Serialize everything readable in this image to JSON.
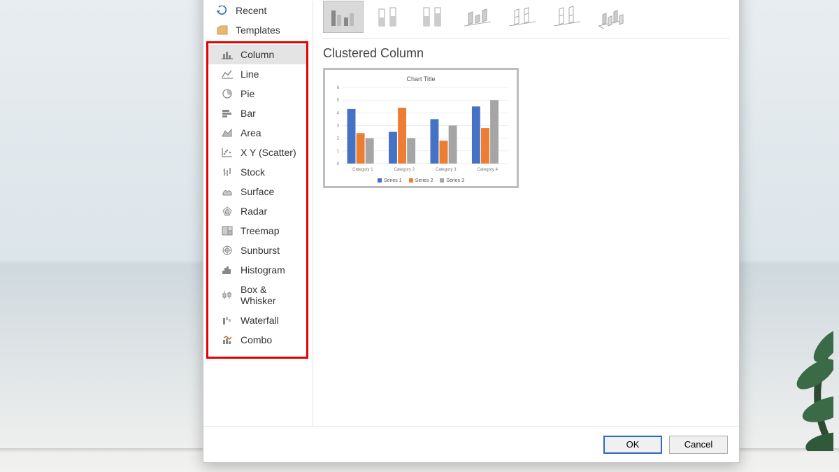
{
  "sidebar": {
    "top": [
      {
        "label": "Recent",
        "icon": "recent-icon"
      },
      {
        "label": "Templates",
        "icon": "templates-icon"
      }
    ],
    "charts": [
      {
        "label": "Column",
        "icon": "column-icon",
        "selected": true
      },
      {
        "label": "Line",
        "icon": "line-icon"
      },
      {
        "label": "Pie",
        "icon": "pie-icon"
      },
      {
        "label": "Bar",
        "icon": "bar-icon"
      },
      {
        "label": "Area",
        "icon": "area-icon"
      },
      {
        "label": "X Y (Scatter)",
        "icon": "scatter-icon"
      },
      {
        "label": "Stock",
        "icon": "stock-icon"
      },
      {
        "label": "Surface",
        "icon": "surface-icon"
      },
      {
        "label": "Radar",
        "icon": "radar-icon"
      },
      {
        "label": "Treemap",
        "icon": "treemap-icon"
      },
      {
        "label": "Sunburst",
        "icon": "sunburst-icon"
      },
      {
        "label": "Histogram",
        "icon": "histogram-icon"
      },
      {
        "label": "Box & Whisker",
        "icon": "boxwhisker-icon"
      },
      {
        "label": "Waterfall",
        "icon": "waterfall-icon"
      },
      {
        "label": "Combo",
        "icon": "combo-icon"
      }
    ]
  },
  "subtypes": [
    {
      "name": "clustered-column",
      "selected": true
    },
    {
      "name": "stacked-column"
    },
    {
      "name": "100-stacked-column"
    },
    {
      "name": "3d-clustered-column"
    },
    {
      "name": "3d-stacked-column"
    },
    {
      "name": "3d-100-stacked-column"
    },
    {
      "name": "3d-column"
    }
  ],
  "preview": {
    "title": "Clustered Column",
    "chart_title": "Chart Title",
    "legend": [
      "Series 1",
      "Series 2",
      "Series 3"
    ]
  },
  "buttons": {
    "ok": "OK",
    "cancel": "Cancel"
  },
  "chart_data": {
    "type": "bar",
    "title": "Chart Title",
    "categories": [
      "Category 1",
      "Category 2",
      "Category 3",
      "Category 4"
    ],
    "series": [
      {
        "name": "Series 1",
        "values": [
          4.3,
          2.5,
          3.5,
          4.5
        ],
        "color": "#4472c4"
      },
      {
        "name": "Series 2",
        "values": [
          2.4,
          4.4,
          1.8,
          2.8
        ],
        "color": "#ed7d31"
      },
      {
        "name": "Series 3",
        "values": [
          2.0,
          2.0,
          3.0,
          5.0
        ],
        "color": "#a5a5a5"
      }
    ],
    "ylim": [
      0,
      6
    ],
    "xlabel": "",
    "ylabel": ""
  }
}
